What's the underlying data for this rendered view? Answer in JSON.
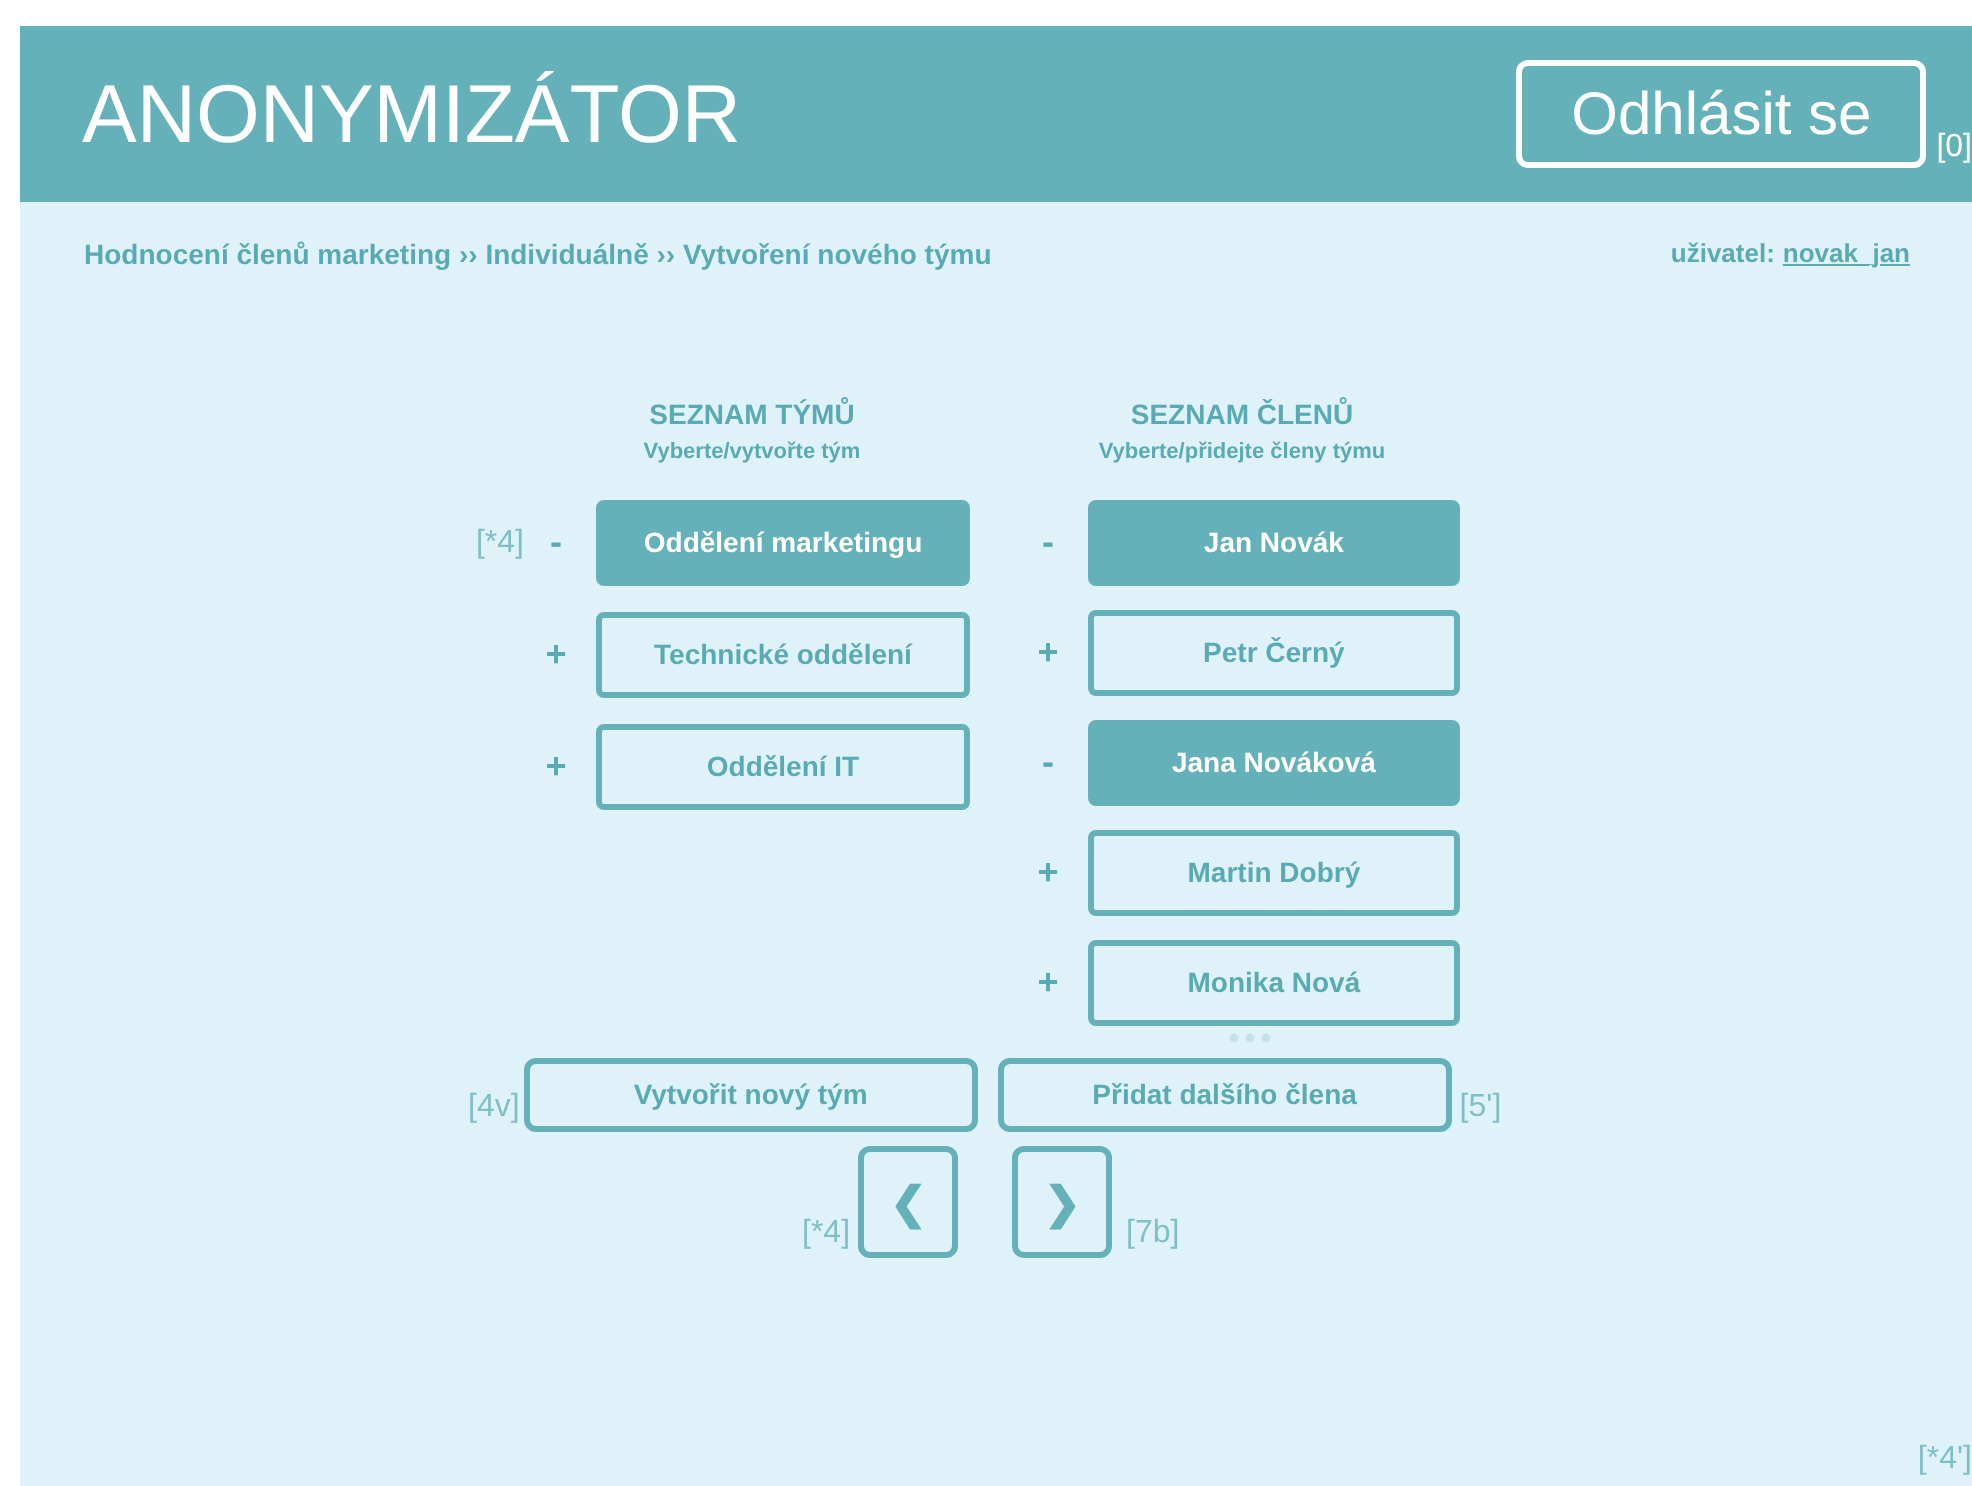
{
  "header": {
    "title": "ANONYMIZÁTOR",
    "logout_button": "Odhlásit se",
    "annotation": "[0]"
  },
  "breadcrumb": "Hodnocení členů marketing ›› Individuálně ›› Vytvoření nového týmu",
  "user": {
    "label": "uživatel:",
    "name": "novak_jan"
  },
  "teams": {
    "heading": "SEZNAM TÝMŮ",
    "subheading": "Vyberte/vytvořte tým",
    "items": [
      {
        "sign": "-",
        "label": "Oddělení marketingu",
        "selected": true,
        "annotation": "[*4]"
      },
      {
        "sign": "+",
        "label": "Technické oddělení",
        "selected": false
      },
      {
        "sign": "+",
        "label": "Oddělení IT",
        "selected": false
      }
    ]
  },
  "members": {
    "heading": "SEZNAM ČLENŮ",
    "subheading": "Vyberte/přidejte členy týmu",
    "items": [
      {
        "sign": "-",
        "label": "Jan Novák",
        "selected": true
      },
      {
        "sign": "+",
        "label": "Petr Černý",
        "selected": false
      },
      {
        "sign": "-",
        "label": "Jana Nováková",
        "selected": true
      },
      {
        "sign": "+",
        "label": "Martin Dobrý",
        "selected": false
      },
      {
        "sign": "+",
        "label": "Monika Nová",
        "selected": false
      }
    ]
  },
  "buttons": [
    {
      "label": "Vytvořit nový tým",
      "annotation": "[4v]"
    },
    {
      "label": "Přidat dalšího člena",
      "annotation": "[5']"
    }
  ],
  "nav": [
    {
      "glyph": "❮",
      "annotation": "[*4]"
    },
    {
      "glyph": "❯",
      "annotation": "[7b]"
    }
  ],
  "corner_annotation": "[*4']"
}
